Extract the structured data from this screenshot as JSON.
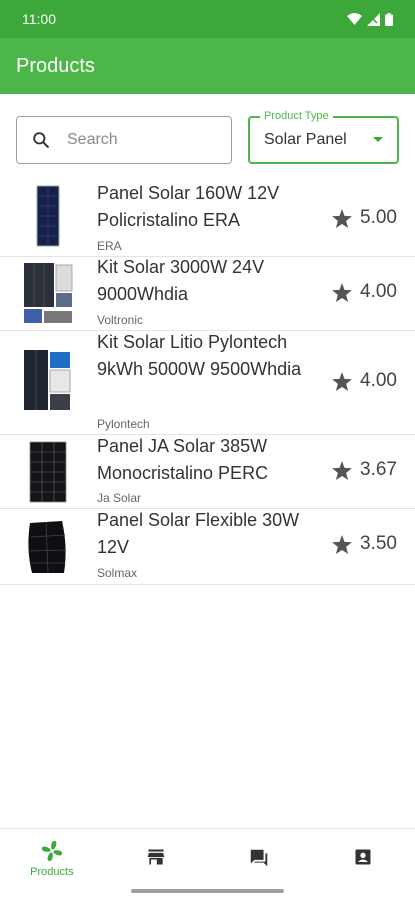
{
  "status_bar": {
    "time": "11:00"
  },
  "app_bar": {
    "title": "Products"
  },
  "filters": {
    "search": {
      "placeholder": "Search",
      "value": ""
    },
    "product_type": {
      "label": "Product Type",
      "value": "Solar Panel"
    }
  },
  "products": [
    {
      "name": "Panel Solar 160W 12V Policristalino ERA",
      "brand": "ERA",
      "rating": "5.00"
    },
    {
      "name": "Kit Solar 3000W 24V 9000Whdia",
      "brand": "Voltronic",
      "rating": "4.00"
    },
    {
      "name": "Kit Solar Litio Pylontech 9kWh 5000W 9500Whdia",
      "brand": "Pylontech",
      "rating": "4.00"
    },
    {
      "name": "Panel JA Solar 385W Monocristalino PERC",
      "brand": "Ja Solar",
      "rating": "3.67"
    },
    {
      "name": "Panel Solar Flexible 30W 12V",
      "brand": "Solmax",
      "rating": "3.50"
    }
  ],
  "bottom_nav": {
    "items": [
      {
        "label": "Products",
        "icon": "fan-icon",
        "active": true
      },
      {
        "label": "",
        "icon": "store-icon",
        "active": false
      },
      {
        "label": "",
        "icon": "chat-icon",
        "active": false
      },
      {
        "label": "",
        "icon": "contact-icon",
        "active": false
      }
    ]
  },
  "colors": {
    "primary": "#4cb748",
    "status_bar": "#3da83a",
    "accent": "#3da83a"
  }
}
